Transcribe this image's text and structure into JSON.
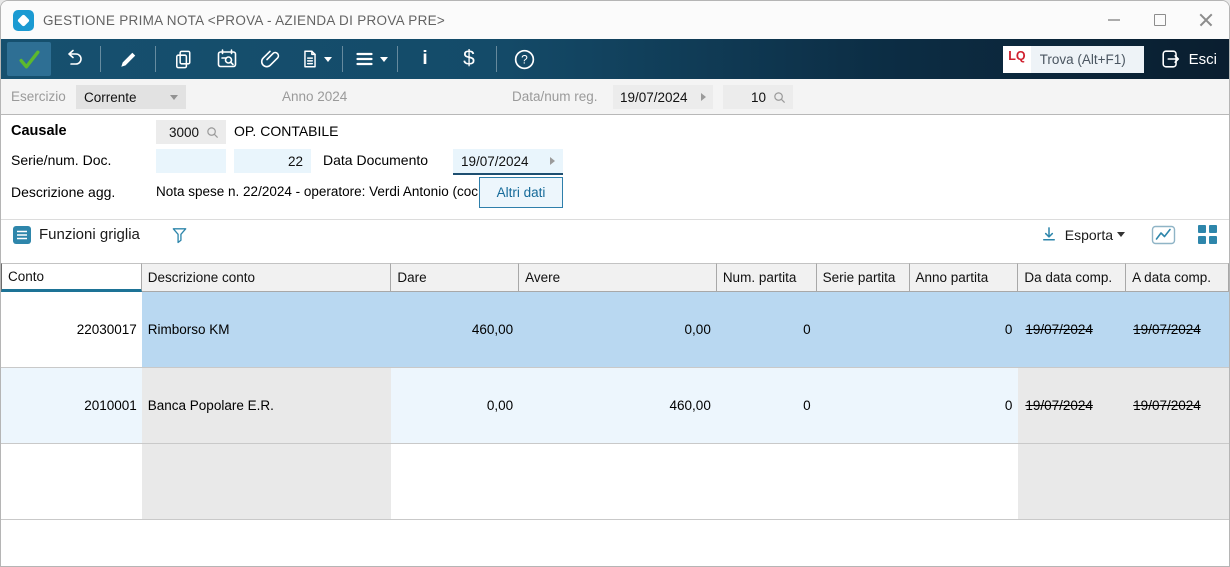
{
  "window": {
    "title": "GESTIONE PRIMA NOTA <PROVA - AZIENDA DI PROVA PRE>",
    "controls": [
      "minimize",
      "maximize",
      "close"
    ]
  },
  "toolbar": {
    "icons": [
      "confirm-check",
      "undo",
      "edit-pencil",
      "copy",
      "calendar-search",
      "attachment",
      "document",
      "menu",
      "info",
      "amounts-dollar",
      "help"
    ],
    "info_glyph": "i",
    "dollar_glyph": "$",
    "help_glyph": "?",
    "lq_label": "LQ",
    "search_placeholder": "Trova (Alt+F1)",
    "exit_label": "Esci"
  },
  "filterbar": {
    "esercizio_label": "Esercizio",
    "esercizio_value": "Corrente",
    "anno_text": "Anno 2024",
    "data_num_label": "Data/num reg.",
    "data_reg_value": "19/07/2024",
    "num_reg_value": "10"
  },
  "form": {
    "causale_label": "Causale",
    "causale_code": "3000",
    "causale_desc": "OP. CONTABILE",
    "serie_label": "Serie/num. Doc.",
    "serie_value": "",
    "num_doc_value": "22",
    "data_doc_label": "Data Documento",
    "data_doc_value": "19/07/2024",
    "descrizione_label": "Descrizione agg.",
    "descrizione_value": "Nota spese n. 22/2024 - operatore: Verdi Antonio (coc",
    "altri_dati_label": "Altri dati"
  },
  "gridbar": {
    "funzioni_label": "Funzioni griglia",
    "esporta_label": "Esporta",
    "icons": [
      "grid-functions",
      "filter-funnel",
      "download-export",
      "line-chart",
      "grid-view"
    ]
  },
  "table": {
    "columns": [
      "Conto",
      "Descrizione conto",
      "Dare",
      "Avere",
      "Num. partita",
      "Serie partita",
      "Anno partita",
      "Da data comp.",
      "A data comp."
    ],
    "rows": [
      {
        "conto": "22030017",
        "descrizione": "Rimborso KM",
        "dare": "460,00",
        "avere": "0,00",
        "num_partita": "0",
        "serie_partita": "",
        "anno_partita": "0",
        "da_data": "19/07/2024",
        "a_data": "19/07/2024"
      },
      {
        "conto": "2010001",
        "descrizione": "Banca Popolare E.R.",
        "dare": "0,00",
        "avere": "460,00",
        "num_partita": "0",
        "serie_partita": "",
        "anno_partita": "0",
        "da_data": "19/07/2024",
        "a_data": "19/07/2024"
      },
      {
        "conto": "",
        "descrizione": "",
        "dare": "",
        "avere": "",
        "num_partita": "",
        "serie_partita": "",
        "anno_partita": "",
        "da_data": "",
        "a_data": ""
      }
    ]
  },
  "colors": {
    "toolbar_teal": "#16506f",
    "toolbar_dark": "#0a1e2f",
    "accent_teal": "#2e86ab",
    "selection_blue": "#b9d8f1",
    "row_lightblue": "#edf6fd",
    "cell_gray": "#e9e9e9",
    "check_green": "#5cb82e",
    "lq_red": "#d0202e"
  }
}
